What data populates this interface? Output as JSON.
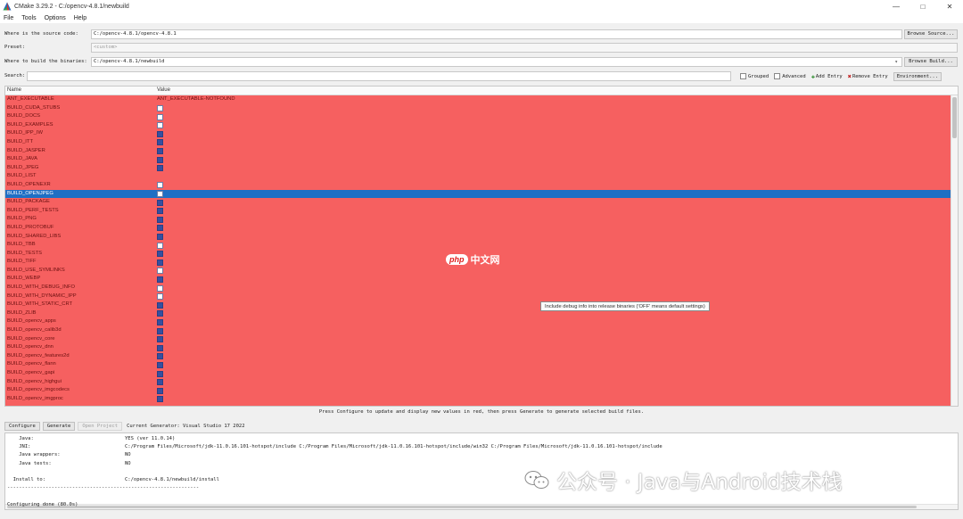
{
  "window": {
    "title": "CMake 3.29.2 - C:/opencv-4.8.1/newbuild",
    "controls": {
      "minimize": "—",
      "maximize": "□",
      "close": "✕"
    }
  },
  "menu": [
    "File",
    "Tools",
    "Options",
    "Help"
  ],
  "source": {
    "label": "Where is the source code:",
    "value": "C:/opencv-4.8.1/opencv-4.8.1",
    "button": "Browse Source..."
  },
  "preset": {
    "label": "Preset:",
    "value": "<custom>"
  },
  "build": {
    "label": "Where to build the binaries:",
    "value": "C:/opencv-4.8.1/newbuild",
    "button": "Browse Build..."
  },
  "search": {
    "label": "Search:",
    "value": "",
    "grouped": "Grouped",
    "advanced": "Advanced",
    "add_entry": "Add Entry",
    "remove_entry": "Remove Entry",
    "environment": "Environment..."
  },
  "table": {
    "col_name": "Name",
    "col_value": "Value",
    "rows": [
      {
        "name": "ANT_EXECUTABLE",
        "value": "ANT_EXECUTABLE-NOTFOUND",
        "type": "text"
      },
      {
        "name": "BUILD_CUDA_STUBS",
        "checked": false,
        "type": "bool"
      },
      {
        "name": "BUILD_DOCS",
        "checked": false,
        "type": "bool"
      },
      {
        "name": "BUILD_EXAMPLES",
        "checked": false,
        "type": "bool"
      },
      {
        "name": "BUILD_IPP_IW",
        "checked": true,
        "type": "bool"
      },
      {
        "name": "BUILD_ITT",
        "checked": true,
        "type": "bool"
      },
      {
        "name": "BUILD_JASPER",
        "checked": true,
        "type": "bool"
      },
      {
        "name": "BUILD_JAVA",
        "checked": true,
        "type": "bool"
      },
      {
        "name": "BUILD_JPEG",
        "checked": true,
        "type": "bool"
      },
      {
        "name": "BUILD_LIST",
        "value": "",
        "type": "text"
      },
      {
        "name": "BUILD_OPENEXR",
        "checked": false,
        "type": "bool"
      },
      {
        "name": "BUILD_OPENJPEG",
        "checked": false,
        "type": "bool",
        "selected": true
      },
      {
        "name": "BUILD_PACKAGE",
        "checked": true,
        "type": "bool"
      },
      {
        "name": "BUILD_PERF_TESTS",
        "checked": true,
        "type": "bool"
      },
      {
        "name": "BUILD_PNG",
        "checked": true,
        "type": "bool"
      },
      {
        "name": "BUILD_PROTOBUF",
        "checked": true,
        "type": "bool"
      },
      {
        "name": "BUILD_SHARED_LIBS",
        "checked": true,
        "type": "bool"
      },
      {
        "name": "BUILD_TBB",
        "checked": false,
        "type": "bool"
      },
      {
        "name": "BUILD_TESTS",
        "checked": true,
        "type": "bool"
      },
      {
        "name": "BUILD_TIFF",
        "checked": true,
        "type": "bool"
      },
      {
        "name": "BUILD_USE_SYMLINKS",
        "checked": false,
        "type": "bool"
      },
      {
        "name": "BUILD_WEBP",
        "checked": true,
        "type": "bool"
      },
      {
        "name": "BUILD_WITH_DEBUG_INFO",
        "checked": false,
        "type": "bool"
      },
      {
        "name": "BUILD_WITH_DYNAMIC_IPP",
        "checked": false,
        "type": "bool"
      },
      {
        "name": "BUILD_WITH_STATIC_CRT",
        "checked": true,
        "type": "bool"
      },
      {
        "name": "BUILD_ZLIB",
        "checked": true,
        "type": "bool"
      },
      {
        "name": "BUILD_opencv_apps",
        "checked": true,
        "type": "bool"
      },
      {
        "name": "BUILD_opencv_calib3d",
        "checked": true,
        "type": "bool"
      },
      {
        "name": "BUILD_opencv_core",
        "checked": true,
        "type": "bool"
      },
      {
        "name": "BUILD_opencv_dnn",
        "checked": true,
        "type": "bool"
      },
      {
        "name": "BUILD_opencv_features2d",
        "checked": true,
        "type": "bool"
      },
      {
        "name": "BUILD_opencv_flann",
        "checked": true,
        "type": "bool"
      },
      {
        "name": "BUILD_opencv_gapi",
        "checked": true,
        "type": "bool"
      },
      {
        "name": "BUILD_opencv_highgui",
        "checked": true,
        "type": "bool"
      },
      {
        "name": "BUILD_opencv_imgcodecs",
        "checked": true,
        "type": "bool"
      },
      {
        "name": "BUILD_opencv_imgproc",
        "checked": true,
        "type": "bool"
      }
    ]
  },
  "tooltip": "Include debug info into release binaries ('OFF' means default settings)",
  "status_message": "Press Configure to update and display new values in red, then press Generate to generate selected build files.",
  "actions": {
    "configure": "Configure",
    "generate": "Generate",
    "open_project": "Open Project",
    "current_generator": "Current Generator: Visual Studio 17 2022"
  },
  "output": {
    "lines": [
      {
        "key": "    Java:",
        "val": "YES (ver 11.0.14)"
      },
      {
        "key": "    JNI:",
        "val": "C:/Program Files/Microsoft/jdk-11.0.16.101-hotspot/include C:/Program Files/Microsoft/jdk-11.0.16.101-hotspot/include/win32 C:/Program Files/Microsoft/jdk-11.0.16.101-hotspot/include"
      },
      {
        "key": "    Java wrappers:",
        "val": "NO"
      },
      {
        "key": "    Java tests:",
        "val": "NO"
      },
      {
        "key": "",
        "val": ""
      },
      {
        "key": "  Install to:",
        "val": "C:/opencv-4.8.1/newbuild/install"
      },
      {
        "key": "-----------------------------------------------------------------",
        "val": ""
      },
      {
        "key": "",
        "val": ""
      },
      {
        "key": "Configuring done (80.0s)",
        "val": ""
      }
    ]
  },
  "watermarks": {
    "site_badge": "php",
    "site_name": "中文网",
    "wechat": "公众号 · Java与Android技术栈"
  },
  "colors": {
    "error_row": "#f66060",
    "selected_row": "#1f6fc4",
    "checkbox_checked": "#3550a0"
  }
}
